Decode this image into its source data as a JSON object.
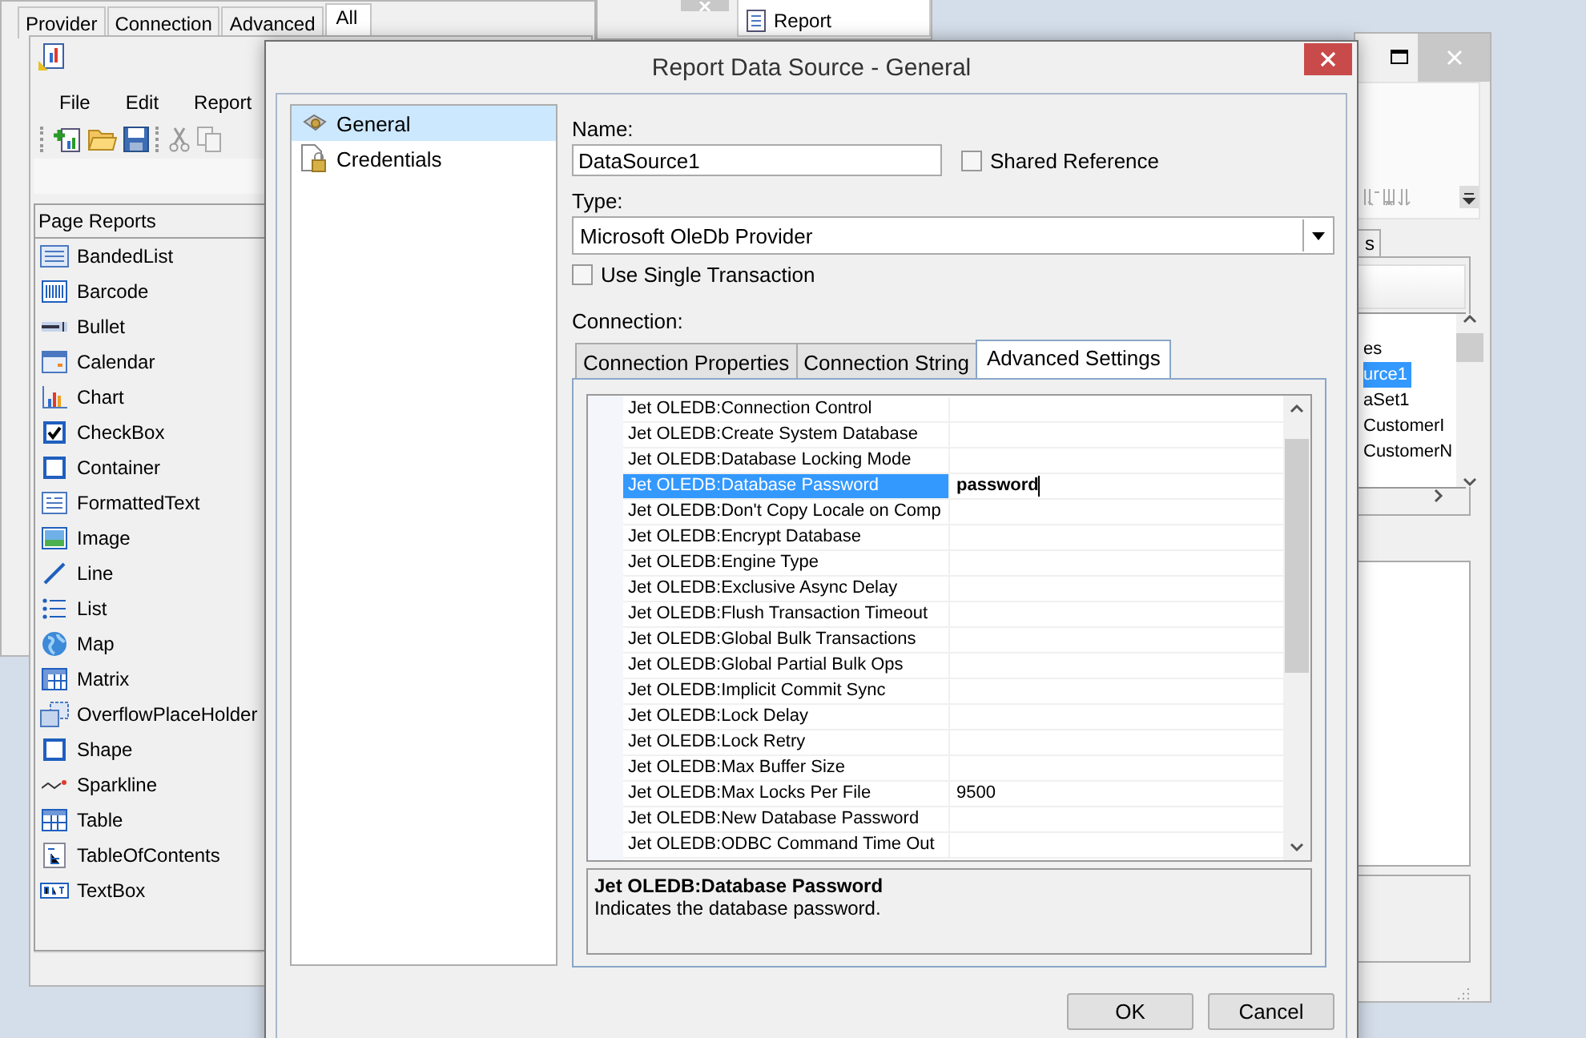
{
  "back_window": {
    "tabs": [
      {
        "label": "Provider",
        "selected": false
      },
      {
        "label": "Connection",
        "selected": false
      },
      {
        "label": "Advanced",
        "selected": false
      },
      {
        "label": "All",
        "selected": true
      }
    ]
  },
  "middle_window": {
    "items": [
      {
        "label": "Report"
      }
    ]
  },
  "designer": {
    "menu": [
      "File",
      "Edit",
      "Report"
    ],
    "toolbox": {
      "header": "Page Reports",
      "items": [
        "BandedList",
        "Barcode",
        "Bullet",
        "Calendar",
        "Chart",
        "CheckBox",
        "Container",
        "FormattedText",
        "Image",
        "Line",
        "List",
        "Map",
        "Matrix",
        "OverflowPlaceHolder",
        "Shape",
        "Sparkline",
        "Table",
        "TableOfContents",
        "TextBox"
      ]
    }
  },
  "right_window": {
    "tab": "s",
    "tree_items": [
      {
        "label": "es",
        "selected": false
      },
      {
        "label": "urce1",
        "selected": true
      },
      {
        "label": "aSet1",
        "selected": false
      },
      {
        "label": "CustomerI",
        "selected": false
      },
      {
        "label": "CustomerN",
        "selected": false
      }
    ]
  },
  "dialog": {
    "title": "Report Data Source - General",
    "nav": [
      {
        "label": "General",
        "selected": true
      },
      {
        "label": "Credentials",
        "selected": false
      }
    ],
    "name_label": "Name:",
    "name_value": "DataSource1",
    "shared_reference": {
      "label": "Shared Reference",
      "checked": false
    },
    "type_label": "Type:",
    "type_value": "Microsoft OleDb Provider",
    "single_transaction": {
      "label": "Use Single Transaction",
      "checked": false
    },
    "connection_label": "Connection:",
    "tabs": [
      {
        "label": "Connection Properties",
        "selected": false
      },
      {
        "label": "Connection String",
        "selected": false
      },
      {
        "label": "Advanced Settings",
        "selected": true
      }
    ],
    "properties": [
      {
        "name": "Jet OLEDB:Connection Control",
        "selected": false
      },
      {
        "name": "Jet OLEDB:Create System Database",
        "selected": false
      },
      {
        "name": "Jet OLEDB:Database Locking Mode",
        "selected": false
      },
      {
        "name": "Jet OLEDB:Database Password",
        "value": "password",
        "selected": true
      },
      {
        "name": "Jet OLEDB:Don't Copy Locale on Comp",
        "selected": false
      },
      {
        "name": "Jet OLEDB:Encrypt Database",
        "selected": false
      },
      {
        "name": "Jet OLEDB:Engine Type",
        "selected": false
      },
      {
        "name": "Jet OLEDB:Exclusive Async Delay",
        "selected": false
      },
      {
        "name": "Jet OLEDB:Flush Transaction Timeout",
        "selected": false
      },
      {
        "name": "Jet OLEDB:Global Bulk Transactions",
        "selected": false
      },
      {
        "name": "Jet OLEDB:Global Partial Bulk Ops",
        "selected": false
      },
      {
        "name": "Jet OLEDB:Implicit Commit Sync",
        "selected": false
      },
      {
        "name": "Jet OLEDB:Lock Delay",
        "selected": false
      },
      {
        "name": "Jet OLEDB:Lock Retry",
        "selected": false
      },
      {
        "name": "Jet OLEDB:Max Buffer Size",
        "selected": false
      },
      {
        "name": "Jet OLEDB:Max Locks Per File",
        "value": "9500",
        "selected": false
      },
      {
        "name": "Jet OLEDB:New Database Password",
        "selected": false
      },
      {
        "name": "Jet OLEDB:ODBC Command Time Out",
        "selected": false
      }
    ],
    "description": {
      "title": "Jet OLEDB:Database Password",
      "text": "Indicates the database password."
    },
    "buttons": [
      "OK",
      "Cancel"
    ]
  }
}
